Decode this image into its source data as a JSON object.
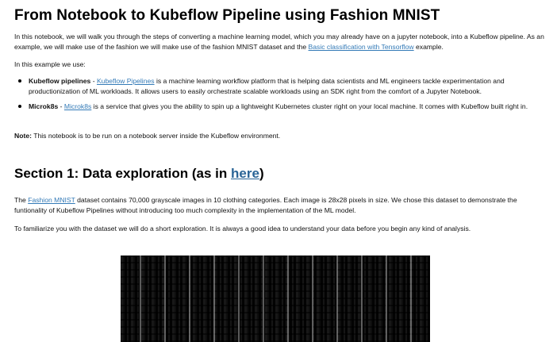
{
  "title": "From Notebook to Kubeflow Pipeline using Fashion MNIST",
  "intro": {
    "text_before": "In this notebook, we will walk you through the steps of converting a machine learning model, which you may already have on a jupyter notebook, into a Kubeflow pipeline. As an example, we will make use of the fashion we will make use of the fashion MNIST dataset and the ",
    "link": "Basic classification with Tensorflow",
    "text_after": " example."
  },
  "example_lead": "In this example we use:",
  "bullets": [
    {
      "term": "Kubeflow pipelines",
      "dash": " - ",
      "link": "Kubeflow Pipelines",
      "text": " is a machine learning workflow platform that is helping data scientists and ML engineers tackle experimentation and productionization of ML workloads. It allows users to easily orchestrate scalable workloads using an SDK right from the comfort of a Jupyter Notebook."
    },
    {
      "term": "Microk8s",
      "dash": " - ",
      "link": "Microk8s",
      "text": " is a service that gives you the ability to spin up a lightweight Kubernetes cluster right on your local machine. It comes with Kubeflow built right in."
    }
  ],
  "note": {
    "label": "Note:",
    "text": " This notebook is to be run on a notebook server inside the Kubeflow environment."
  },
  "section1": {
    "heading_text": "Section 1: Data exploration (as in ",
    "heading_link": "here",
    "heading_close": ")",
    "p1_before": "The ",
    "p1_link": "Fashion MNIST",
    "p1_after": " dataset contains 70,000 grayscale images in 10 clothing categories. Each image is 28x28 pixels in size. We chose this dataset to demonstrate the funtionality of Kubeflow Pipelines without introducing too much complexity in the implementation of the ML model.",
    "p2": "To familiarize you with the dataset we will do a short exploration. It is always a good idea to understand your data before you begin any kind of analysis."
  },
  "colors": {
    "link": "#337ab7",
    "heading_link": "#2a6496"
  }
}
